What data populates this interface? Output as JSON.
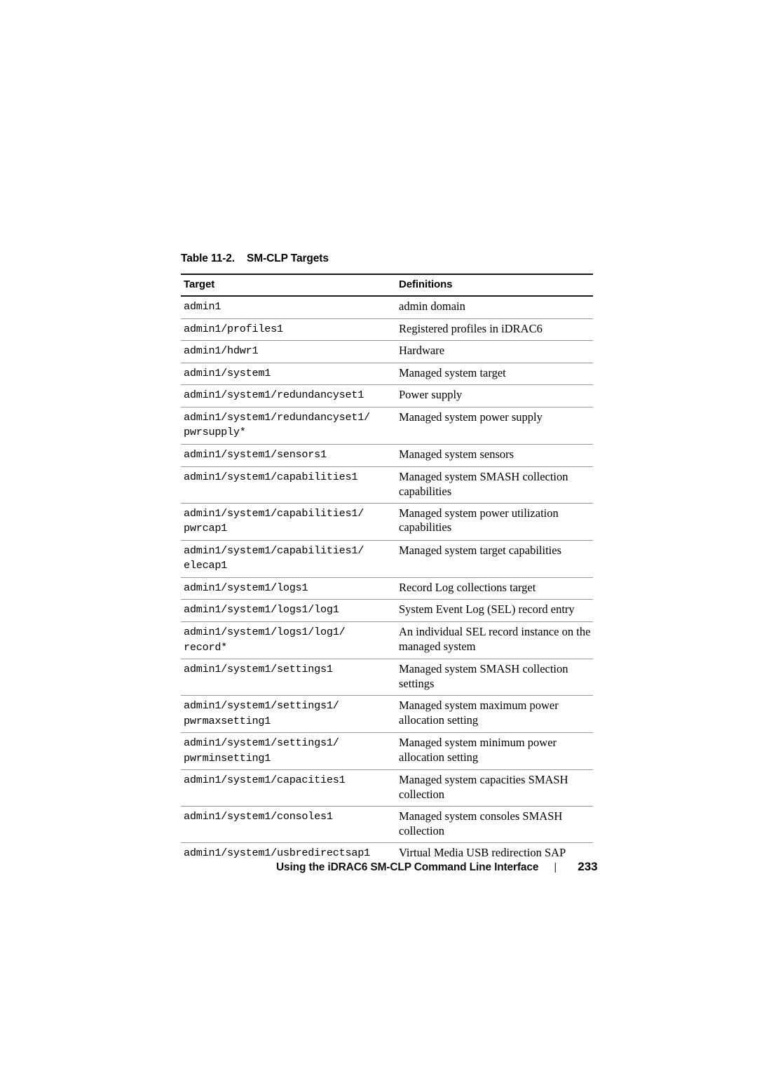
{
  "table": {
    "caption_number": "Table 11-2.",
    "caption_title": "SM-CLP Targets",
    "columns": [
      "Target",
      "Definitions"
    ],
    "rows": [
      {
        "target": "admin1",
        "definition": "admin domain"
      },
      {
        "target": "admin1/profiles1",
        "definition": "Registered profiles in iDRAC6"
      },
      {
        "target": "admin1/hdwr1",
        "definition": "Hardware"
      },
      {
        "target": "admin1/system1",
        "definition": "Managed system target"
      },
      {
        "target": "admin1/system1/redundancyset1",
        "definition": "Power supply"
      },
      {
        "target": "admin1/system1/redundancyset1/\npwrsupply*",
        "definition": "Managed system power supply"
      },
      {
        "target": "admin1/system1/sensors1",
        "definition": "Managed system sensors"
      },
      {
        "target": "admin1/system1/capabilities1",
        "definition": "Managed system SMASH collection capabilities"
      },
      {
        "target": "admin1/system1/capabilities1/\npwrcap1",
        "definition": "Managed system power utilization capabilities"
      },
      {
        "target": "admin1/system1/capabilities1/\nelecap1",
        "definition": "Managed system target capabilities"
      },
      {
        "target": "admin1/system1/logs1",
        "definition": "Record Log collections target"
      },
      {
        "target": "admin1/system1/logs1/log1",
        "definition": "System Event Log (SEL) record entry"
      },
      {
        "target": "admin1/system1/logs1/log1/\nrecord*",
        "definition": "An individual SEL record instance on the managed system"
      },
      {
        "target": "admin1/system1/settings1",
        "definition": "Managed system SMASH collection settings"
      },
      {
        "target": "admin1/system1/settings1/\npwrmaxsetting1",
        "definition": "Managed system maximum power allocation setting"
      },
      {
        "target": "admin1/system1/settings1/\npwrminsetting1",
        "definition": "Managed system minimum power allocation setting"
      },
      {
        "target": "admin1/system1/capacities1",
        "definition": "Managed system capacities SMASH collection"
      },
      {
        "target": "admin1/system1/consoles1",
        "definition": "Managed system consoles SMASH collection"
      },
      {
        "target": "admin1/system1/usbredirectsap1",
        "definition": "Virtual Media USB redirection SAP"
      }
    ]
  },
  "footer": {
    "chapter_title": "Using the iDRAC6 SM-CLP Command Line Interface",
    "separator": "|",
    "page_number": "233"
  }
}
